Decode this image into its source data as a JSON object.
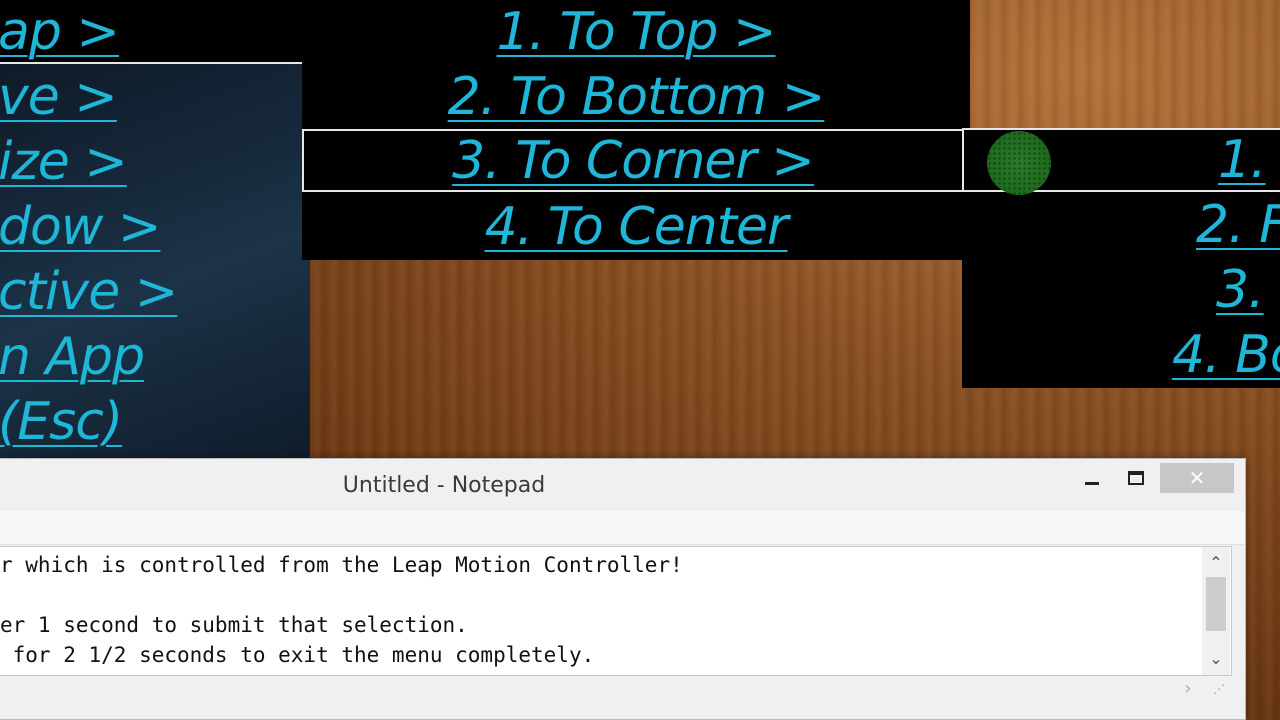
{
  "left_menu": {
    "items": [
      {
        "label": "ap >"
      },
      {
        "label": "ve >"
      },
      {
        "label": "ize >"
      },
      {
        "label": "dow >"
      },
      {
        "label": "ctive >"
      },
      {
        "label": "n App"
      },
      {
        "label": "(Esc)"
      }
    ]
  },
  "middle_menu": {
    "items": [
      {
        "label": "1. To Top >"
      },
      {
        "label": "2. To Bottom >"
      },
      {
        "label": "3. To Corner >"
      },
      {
        "label": "4. To Center"
      }
    ],
    "selected_index": 2
  },
  "right_menu": {
    "items": [
      {
        "label": "1."
      },
      {
        "label": "2. F"
      },
      {
        "label": "3."
      },
      {
        "label": "4. Bo"
      }
    ]
  },
  "colors": {
    "menu_text": "#1fb6d8",
    "menu_bg": "#000000",
    "cursor": "#2c7a2c"
  },
  "notepad": {
    "title": "Untitled - Notepad",
    "close_glyph": "✕",
    "lines": [
      "r which is controlled from the Leap Motion Controller!",
      "",
      "er 1 second to submit that selection.",
      " for 2 1/2 seconds to exit the menu completely."
    ],
    "scroll_up": "⌃",
    "scroll_down": "⌄",
    "scroll_right": "›"
  }
}
